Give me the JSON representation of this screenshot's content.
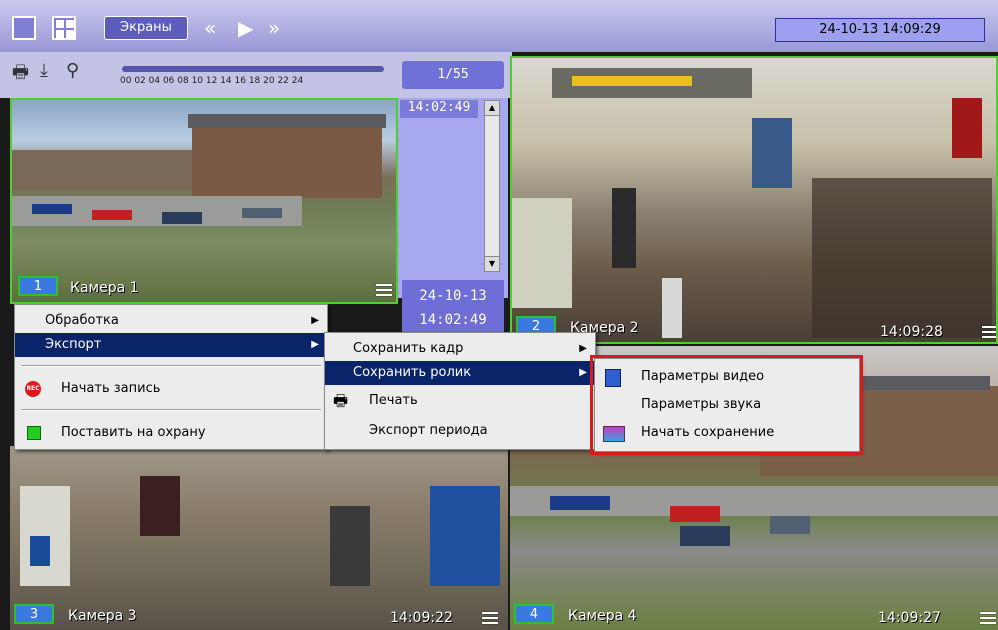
{
  "topbar": {
    "screens_label": "Экраны",
    "datetime": "24-10-13  14:09:29"
  },
  "toolbar": {
    "timeline_labels": "00 02 04 06 08 10  12  14  16  18  20 22  24",
    "frame_counter": "1/55"
  },
  "archive_panel": {
    "time": "14:02:49",
    "date": "24-10-13",
    "date_time": "14:02:49"
  },
  "cameras": [
    {
      "number": "1",
      "name": "Камера 1",
      "time": ""
    },
    {
      "number": "2",
      "name": "Камера 2",
      "time": "14:09:28"
    },
    {
      "number": "3",
      "name": "Камера 3",
      "time": "14:09:22"
    },
    {
      "number": "4",
      "name": "Камера 4",
      "time": "14:09:27"
    }
  ],
  "context_menu": {
    "items": [
      {
        "label": "Обработка",
        "submenu": true
      },
      {
        "label": "Экспорт",
        "submenu": true
      },
      {
        "label": "Начать запись",
        "icon": "rec-icon"
      },
      {
        "label": "Поставить на охрану",
        "icon": "arm-icon"
      }
    ]
  },
  "export_menu": {
    "items": [
      {
        "label": "Сохранить кадр",
        "submenu": true
      },
      {
        "label": "Сохранить ролик",
        "submenu": true
      },
      {
        "label": "Печать",
        "icon": "printer-icon"
      },
      {
        "label": "Экспорт периода"
      }
    ]
  },
  "save_clip_menu": {
    "items": [
      {
        "label": "Параметры видео",
        "icon": "video-settings-icon"
      },
      {
        "label": "Параметры звука"
      },
      {
        "label": "Начать сохранение",
        "icon": "film-save-icon"
      }
    ]
  },
  "colors": {
    "menu_highlight": "#0a246a",
    "active_border": "#55cc33",
    "callout_border": "#d81c1c",
    "topbar_bg": "#9898d8"
  }
}
